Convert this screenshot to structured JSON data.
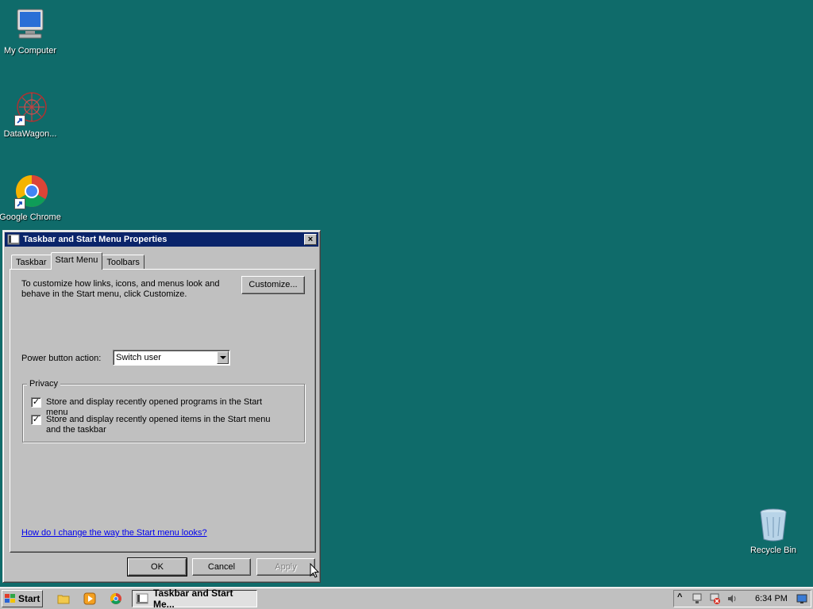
{
  "desktop": {
    "icons": [
      {
        "label": "My Computer"
      },
      {
        "label": "DataWagon..."
      },
      {
        "label": "Google Chrome"
      },
      {
        "label": "Recycle Bin"
      }
    ]
  },
  "window": {
    "title": "Taskbar and Start Menu Properties",
    "close_label": "×",
    "tabs": [
      {
        "label": "Taskbar"
      },
      {
        "label": "Start Menu",
        "active": true
      },
      {
        "label": "Toolbars"
      }
    ],
    "description": "To customize how links, icons, and menus look and behave in the Start menu, click Customize.",
    "customize_label": "Customize...",
    "power_button_label": "Power button action:",
    "power_button_value": "Switch user",
    "privacy": {
      "title": "Privacy",
      "options": [
        {
          "label": "Store and display recently opened programs in the Start menu",
          "checked": true,
          "mark": "✓"
        },
        {
          "label": "Store and display recently opened items in the Start menu and the taskbar",
          "checked": true,
          "mark": "✓"
        }
      ]
    },
    "help_link": "How do I change the way the Start menu looks?",
    "ok_label": "OK",
    "cancel_label": "Cancel",
    "apply_label": "Apply"
  },
  "taskbar": {
    "start_label": "Start",
    "task_label": "Taskbar and Start Me...",
    "clock": "6:34 PM",
    "tray_expand": "^",
    "quick_launch": [
      "explorer-icon",
      "media-player-icon",
      "chrome-icon"
    ],
    "tray_icons": [
      "network-icon",
      "network-error-icon",
      "volume-icon",
      "desktop-icon"
    ]
  },
  "colors": {
    "desktop": "#0f6b6a",
    "titlebar": "#0a246a",
    "face": "#c0c0c0",
    "link": "#0000ee"
  }
}
